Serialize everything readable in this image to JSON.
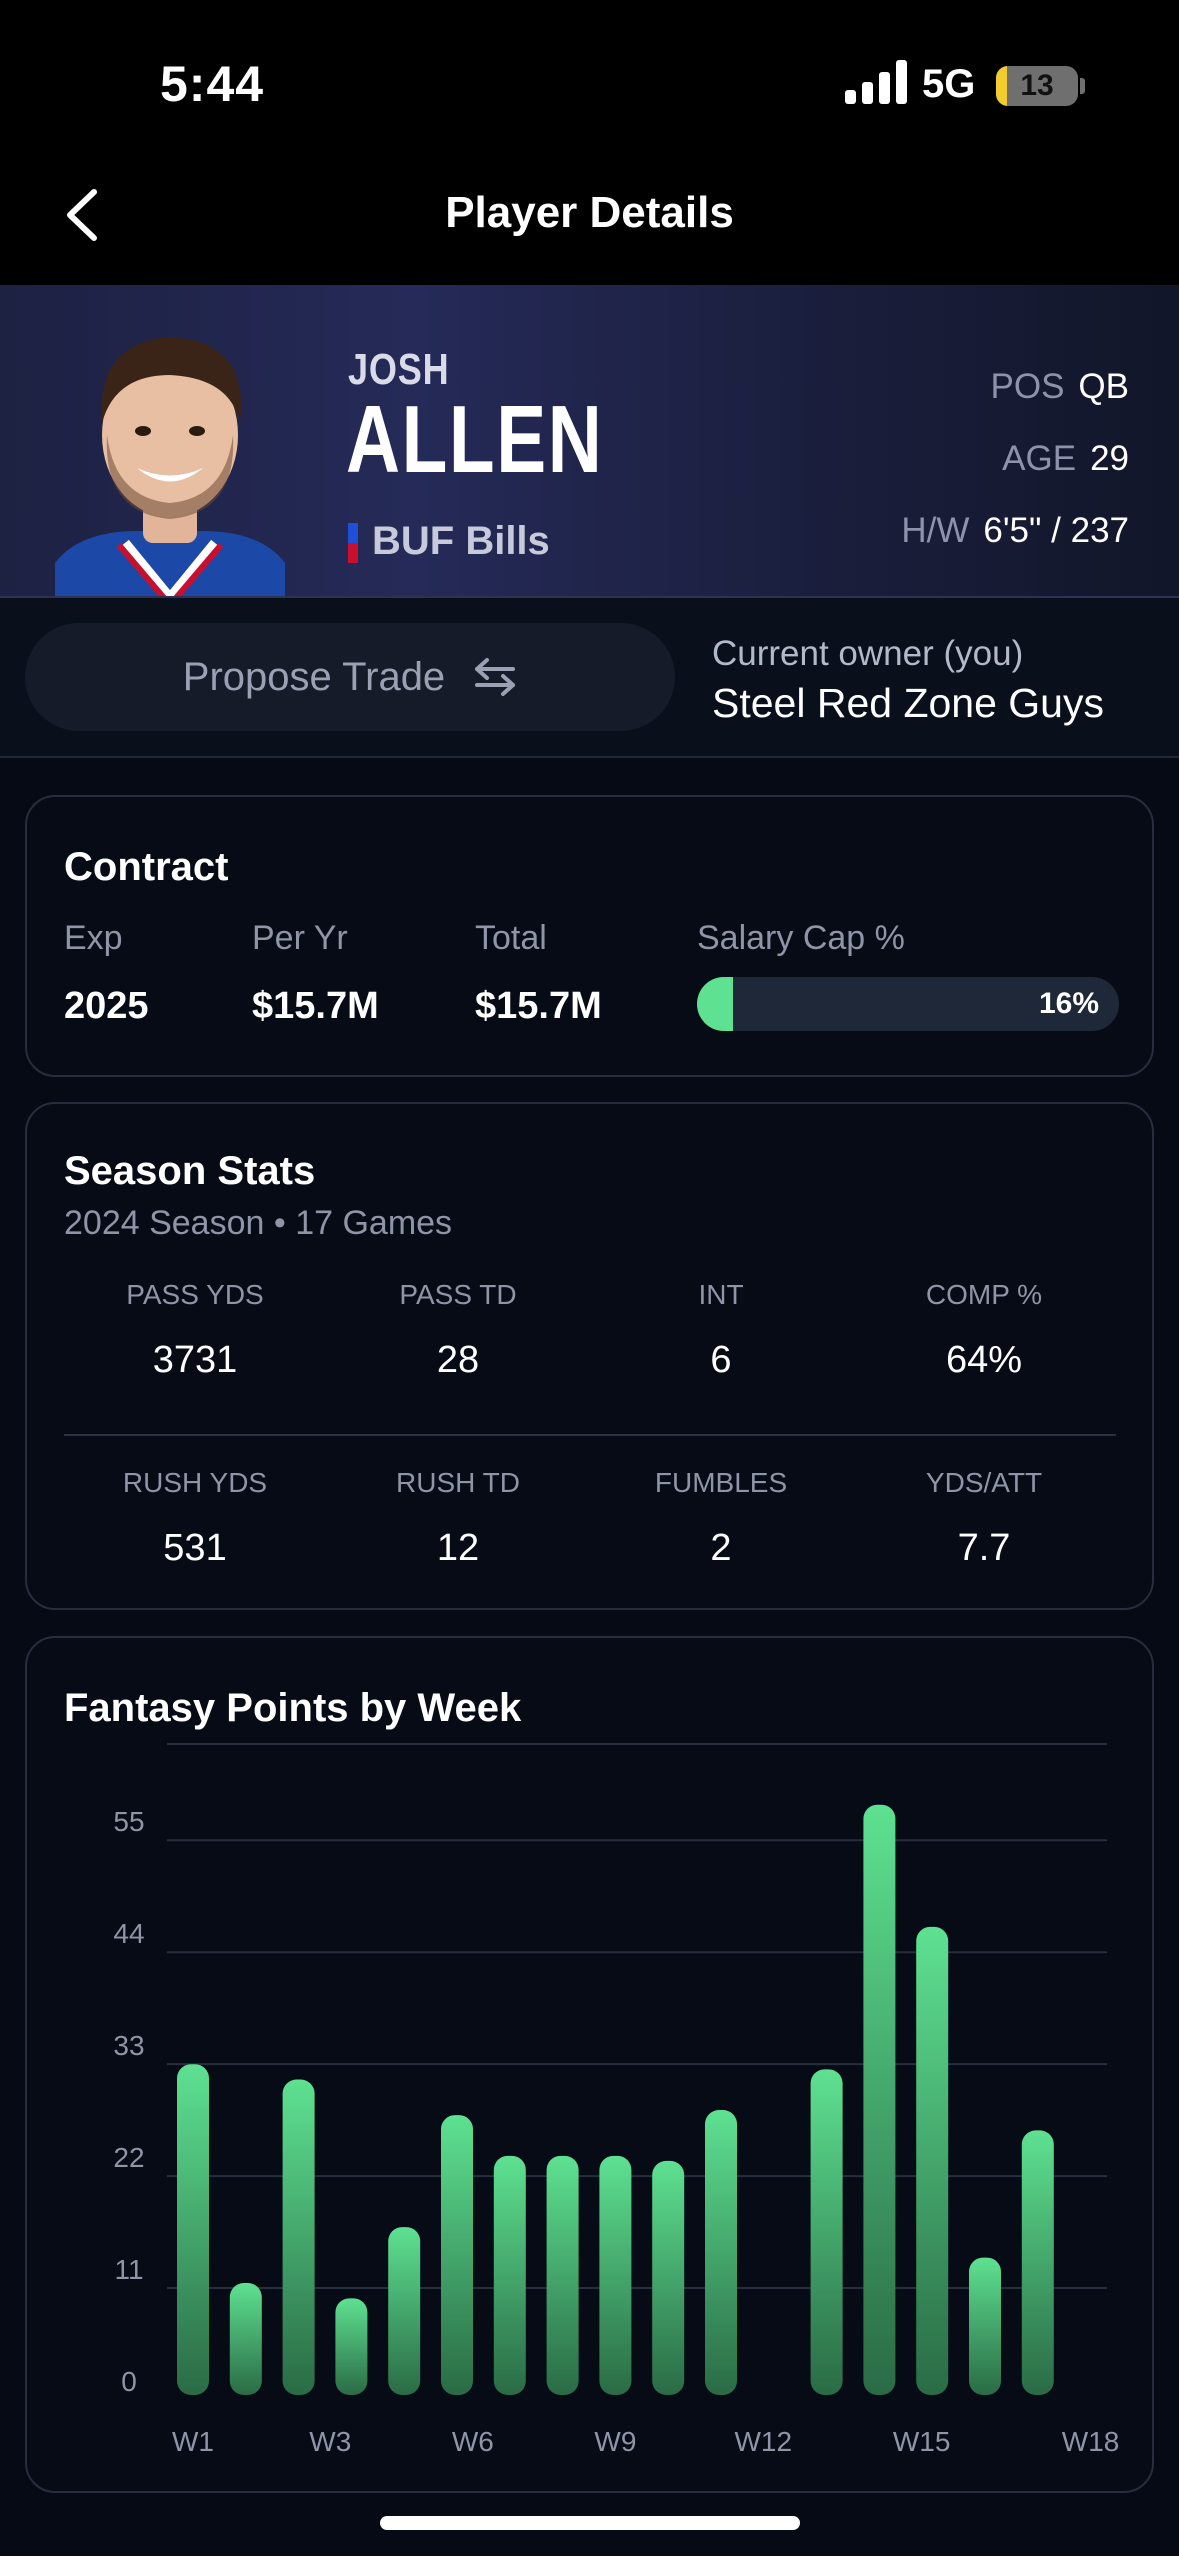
{
  "status": {
    "time": "5:44",
    "network": "5G",
    "battery": "13",
    "battery_level": 0.13
  },
  "nav": {
    "title": "Player Details"
  },
  "player": {
    "first_name": "JOSH",
    "last_name": "ALLEN",
    "team": "BUF Bills",
    "pos_label": "POS",
    "pos": "QB",
    "age_label": "AGE",
    "age": "29",
    "hw_label": "H/W",
    "hw": "6'5\" / 237"
  },
  "trade": {
    "propose_label": "Propose Trade",
    "owner_label": "Current owner (you)",
    "owner_name": "Steel Red Zone Guys"
  },
  "contract": {
    "title": "Contract",
    "exp_label": "Exp",
    "exp": "2025",
    "per_yr_label": "Per Yr",
    "per_yr": "$15.7M",
    "total_label": "Total",
    "total": "$15.7M",
    "cap_label": "Salary Cap %",
    "cap_pct": "16%",
    "cap_fraction": 0.085
  },
  "season": {
    "title": "Season Stats",
    "subtitle": "2024 Season • 17 Games",
    "row1": [
      {
        "label": "PASS YDS",
        "value": "3731"
      },
      {
        "label": "PASS TD",
        "value": "28"
      },
      {
        "label": "INT",
        "value": "6"
      },
      {
        "label": "COMP %",
        "value": "64%"
      }
    ],
    "row2": [
      {
        "label": "RUSH YDS",
        "value": "531"
      },
      {
        "label": "RUSH TD",
        "value": "12"
      },
      {
        "label": "FUMBLES",
        "value": "2"
      },
      {
        "label": "YDS/ATT",
        "value": "7.7"
      }
    ]
  },
  "colors": {
    "accent": "#5ee191",
    "team_red": "#c8102e",
    "team_blue": "#1f4fd8"
  },
  "chart_data": {
    "type": "bar",
    "title": "Fantasy Points by Week",
    "categories": [
      "W1",
      "W2",
      "W3",
      "W4",
      "W5",
      "W6",
      "W7",
      "W8",
      "W9",
      "W10",
      "W11",
      "W12",
      "W13",
      "W14",
      "W15",
      "W16",
      "W17",
      "W18"
    ],
    "values": [
      32.5,
      11,
      31,
      9.5,
      16.5,
      27.5,
      23.5,
      23.5,
      23.5,
      23,
      28,
      0,
      32,
      58,
      46,
      13.5,
      26,
      null
    ],
    "tick_labels": [
      "W1",
      "W3",
      "W6",
      "W9",
      "W12",
      "W15",
      "W18"
    ],
    "tick_indices": [
      0,
      2.6,
      5.3,
      8.0,
      10.8,
      13.8,
      17.0
    ],
    "y_ticks": [
      0,
      11,
      22,
      33,
      44,
      55
    ],
    "ylim": [
      0,
      62
    ],
    "grid": true,
    "xlabel": "",
    "ylabel": ""
  }
}
